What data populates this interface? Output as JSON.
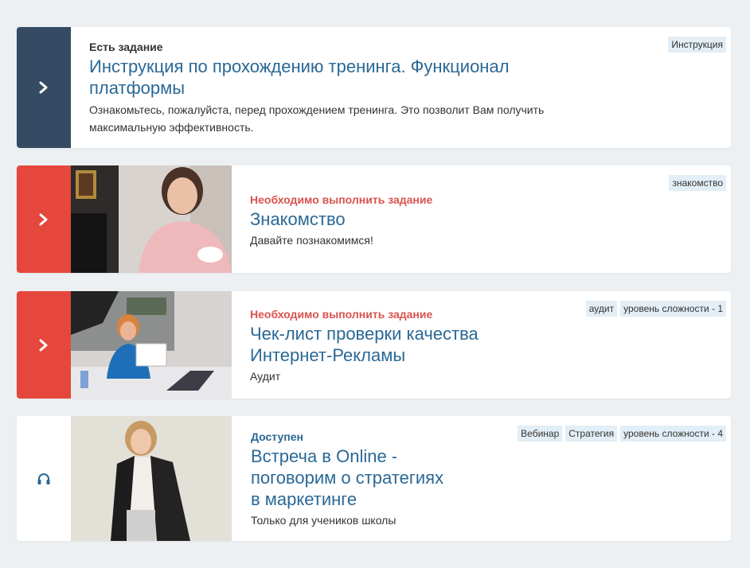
{
  "colors": {
    "page_background": "#edf0f2",
    "side_dark": "#344b63",
    "side_red": "#e5473c",
    "status_dark": "#333333",
    "status_red": "#d9534f",
    "status_available": "#2a6896",
    "title_blue": "#2a6896",
    "tag_background": "#e3eef6"
  },
  "cards": [
    {
      "status": "Есть задание",
      "title_lines": [
        "Инструкция по прохождению тренинга. Функционал",
        "платформы"
      ],
      "description_lines": [
        "Ознакомьтесь, пожалуйста, перед прохождением тренинга. Это позволит Вам получить",
        "максимальную эффективность."
      ],
      "tags": [
        "Инструкция"
      ],
      "side_icon": "chevron-right-icon"
    },
    {
      "status": "Необходимо выполнить задание",
      "title_lines": [
        "Знакомство"
      ],
      "description_lines": [
        "Давайте познакомимся!"
      ],
      "tags": [
        "знакомство"
      ],
      "side_icon": "chevron-right-icon"
    },
    {
      "status": "Необходимо выполнить задание",
      "title_lines": [
        "Чек-лист проверки качества",
        "Интернет-Рекламы"
      ],
      "description_lines": [
        "Аудит"
      ],
      "tags": [
        "аудит",
        "уровень сложности - 1"
      ],
      "side_icon": "chevron-right-icon"
    },
    {
      "status": "Доступен",
      "title_lines": [
        "Встреча в Online -",
        "поговорим о стратегиях",
        "в маркетинге"
      ],
      "description_lines": [
        "Только для учеников школы"
      ],
      "tags": [
        "Вебинар",
        "Стратегия",
        "уровень сложности - 4"
      ],
      "side_icon": "headphones-icon"
    }
  ]
}
